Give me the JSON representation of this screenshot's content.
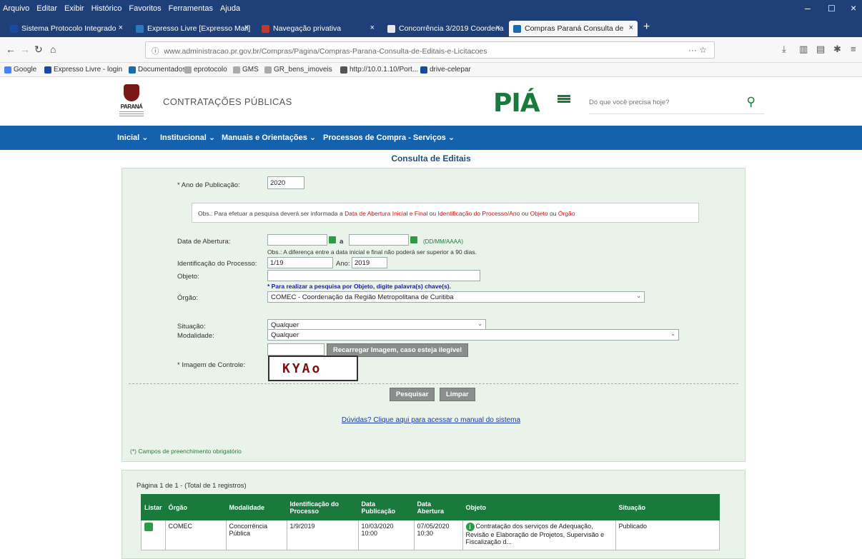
{
  "browser": {
    "menu": [
      "Arquivo",
      "Editar",
      "Exibir",
      "Histórico",
      "Favoritos",
      "Ferramentas",
      "Ajuda"
    ],
    "tabs": [
      {
        "label": "Sistema Protocolo Integrado",
        "color": "#1a4aa0"
      },
      {
        "label": "Expresso Livre [Expresso Mail]",
        "color": "#2a7abf"
      },
      {
        "label": "Navegação privativa",
        "color": "#c0392b"
      },
      {
        "label": "Concorrência 3/2019 Coordena",
        "color": "#e8e8e8"
      },
      {
        "label": "Compras Paraná Consulta de",
        "color": "#1a6ab0"
      }
    ],
    "url": "www.administracao.pr.gov.br/Compras/Pagina/Compras-Parana-Consulta-de-Editais-e-Licitacoes",
    "bookmarks": [
      "Google",
      "Expresso Livre - login",
      "Documentados",
      "eprotocolo",
      "GMS",
      "GR_bens_imoveis",
      "http://10.0.1.10/Port...",
      "drive-celepar"
    ]
  },
  "header": {
    "title": "CONTRATAÇÕES PÚBLICAS",
    "crest_text": "PARANÁ",
    "logo_text": "PIÁ",
    "search_placeholder": "Do que você precisa hoje?"
  },
  "nav": [
    "Inicial",
    "Institucional",
    "Manuais e Orientações",
    "Processos de Compra - Serviços"
  ],
  "form": {
    "page_title": "Consulta de Editais",
    "ano_label": "* Ano de Publicação:",
    "ano_value": "2020",
    "obs_prefix": "Obs.: Para efetuar a pesquisa deverá ser informada a",
    "obs_red1": "Data de Abertura Inicial e Final",
    "obs_mid": "ou",
    "obs_red2": "Identificação do Processo/Ano",
    "obs_mid2": "ou",
    "obs_red3": "Objeto",
    "obs_mid3": "ou",
    "obs_red4": "Órgão",
    "data_label": "Data de Abertura:",
    "data_sep": "a",
    "date_format": "(DD/MM/AAAA)",
    "data_hint": "Obs.: A diferença entre a data inicial e final não poderá ser superior a 90 dias.",
    "ident_label": "Identificação do Processo:",
    "ident_value": "1/19",
    "ano2_label": "Ano:",
    "ano2_value": "2019",
    "objeto_label": "Objeto:",
    "objeto_value": "",
    "objeto_hint": "* Para realizar a pesquisa por Objeto, digite palavra(s) chave(s).",
    "orgao_label": "Órgão:",
    "orgao_value": "COMEC - Coordenação da Região Metropolitana de Curitiba",
    "situacao_label": "Situação:",
    "situacao_value": "Qualquer",
    "modalidade_label": "Modalidade:",
    "modalidade_value": "Qualquer",
    "captcha_input": "",
    "regen_button": "Recarregar Imagem, caso esteja ilegível",
    "captcha_label": "* Imagem de Controle:",
    "captcha_text": "KYAo",
    "search_button": "Pesquisar",
    "clear_button": "Limpar",
    "manual_link": "Dúvidas? Clique aqui para acessar o manual do sistema",
    "required_note": "(*) Campos de preenchimento obrigatório"
  },
  "results": {
    "page_info": "Página 1 de 1 - (Total de 1 registros)",
    "columns": [
      "Listar",
      "Órgão",
      "Modalidade",
      "Identificação do Processo",
      "Data Publicação",
      "Data Abertura",
      "Objeto",
      "Situação"
    ],
    "rows": [
      {
        "orgao": "COMEC",
        "modalidade": "Concorrência Pública",
        "identificacao": "1/9/2019",
        "publicacao": "10/03/2020 10:00",
        "abertura": "07/05/2020 10:30",
        "objeto": "Contratação dos serviços de Adequação, Revisão e Elaboração de Projetos, Supervisão e Fiscalização d...",
        "situacao": "Publicado"
      }
    ]
  }
}
